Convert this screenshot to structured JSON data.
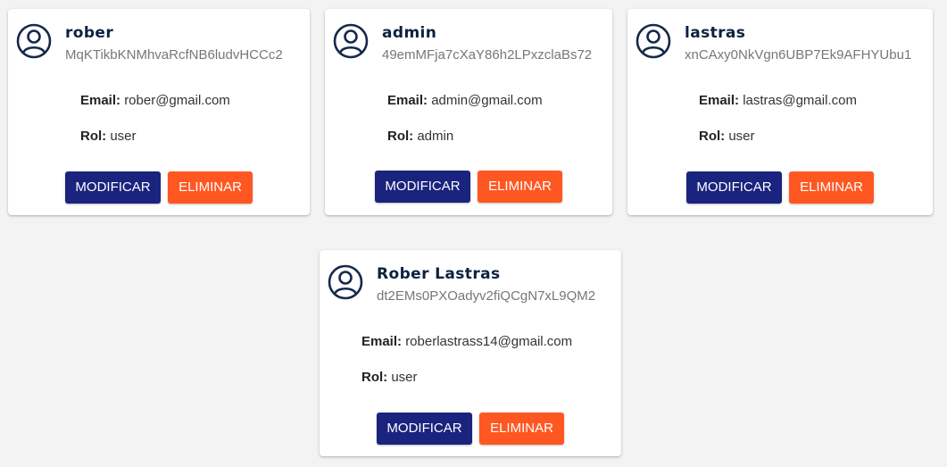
{
  "labels": {
    "email": "Email:",
    "rol": "Rol:",
    "modify": "MODIFICAR",
    "delete": "ELIMINAR"
  },
  "colors": {
    "modify_button": "#1a237e",
    "delete_button": "#ff5722",
    "name_text": "#0d2140",
    "id_text": "#777777"
  },
  "icons": {
    "avatar": "account-circle-icon"
  },
  "users": [
    {
      "name": "rober",
      "id": "MqKTikbKNMhvaRcfNB6ludvHCCc2",
      "email": "rober@gmail.com",
      "rol": "user"
    },
    {
      "name": "admin",
      "id": "49emMFja7cXaY86h2LPxzclaBs72",
      "email": "admin@gmail.com",
      "rol": "admin"
    },
    {
      "name": "lastras",
      "id": "xnCAxy0NkVgn6UBP7Ek9AFHYUbu1",
      "email": "lastras@gmail.com",
      "rol": "user"
    },
    {
      "name": "Rober Lastras",
      "id": "dt2EMs0PXOadyv2fiQCgN7xL9QM2",
      "email": "roberlastrass14@gmail.com",
      "rol": "user"
    }
  ]
}
